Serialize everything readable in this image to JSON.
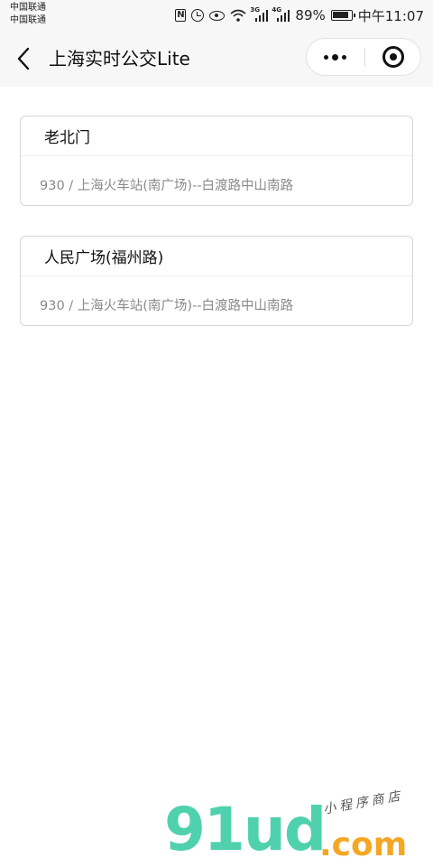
{
  "status_bar": {
    "carrier_1": "中国联通",
    "carrier_2": "中国联通",
    "network_1": "3G",
    "network_2": "4G",
    "battery": "89%",
    "time": "中午11:07"
  },
  "nav": {
    "title": "上海实时公交Lite",
    "icons": {
      "back": "chevron-left-icon",
      "more": "more-dots-icon",
      "close": "target-close-icon"
    }
  },
  "stops": [
    {
      "name": "老北门",
      "route": "930 / 上海火车站(南广场)--白渡路中山南路"
    },
    {
      "name": "人民广场(福州路)",
      "route": "930 / 上海火车站(南广场)--白渡路中山南路"
    }
  ],
  "watermark": {
    "logo": "91ud",
    "domain": ".com",
    "tagline": "小程序商店",
    "colors": {
      "logo": "#4fd1ad",
      "domain": "#f5a623"
    }
  },
  "colors": {
    "background": "#ffffff",
    "bar_background": "#f7f7f7",
    "card_border": "#d6d6d6",
    "route_text": "#8a8a8a"
  }
}
